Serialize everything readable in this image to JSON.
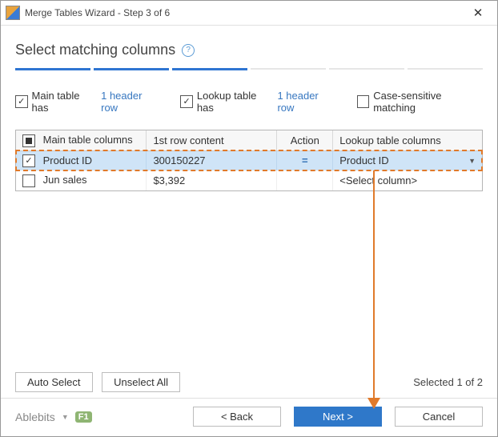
{
  "window": {
    "title": "Merge Tables Wizard - Step 3 of 6"
  },
  "heading": {
    "text": "Select matching columns"
  },
  "wizard": {
    "current_step": 3,
    "total_steps": 6
  },
  "options": {
    "main_checked": true,
    "main_label": "Main table has",
    "main_link": "1 header row",
    "lookup_checked": true,
    "lookup_label": "Lookup table has",
    "lookup_link": "1 header row",
    "case_checked": false,
    "case_label": "Case-sensitive matching"
  },
  "table": {
    "headers": {
      "main": "Main table columns",
      "first_row": "1st row content",
      "action": "Action",
      "lookup": "Lookup table columns"
    },
    "rows": [
      {
        "checked": true,
        "selected": true,
        "main": "Product ID",
        "first_row": "300150227",
        "action": "=",
        "lookup": "Product ID"
      },
      {
        "checked": false,
        "selected": false,
        "main": "Jun sales",
        "first_row": "$3,392",
        "action": "",
        "lookup": "<Select column>"
      }
    ]
  },
  "lower": {
    "auto_select": "Auto Select",
    "unselect_all": "Unselect All",
    "selected_text": "Selected 1 of 2"
  },
  "footer": {
    "brand": "Ablebits",
    "f1": "F1",
    "back": "< Back",
    "next": "Next >",
    "cancel": "Cancel"
  },
  "colors": {
    "accent": "#2f78c9",
    "highlight_row": "#cfe4f7",
    "annotation": "#e07a2b"
  }
}
